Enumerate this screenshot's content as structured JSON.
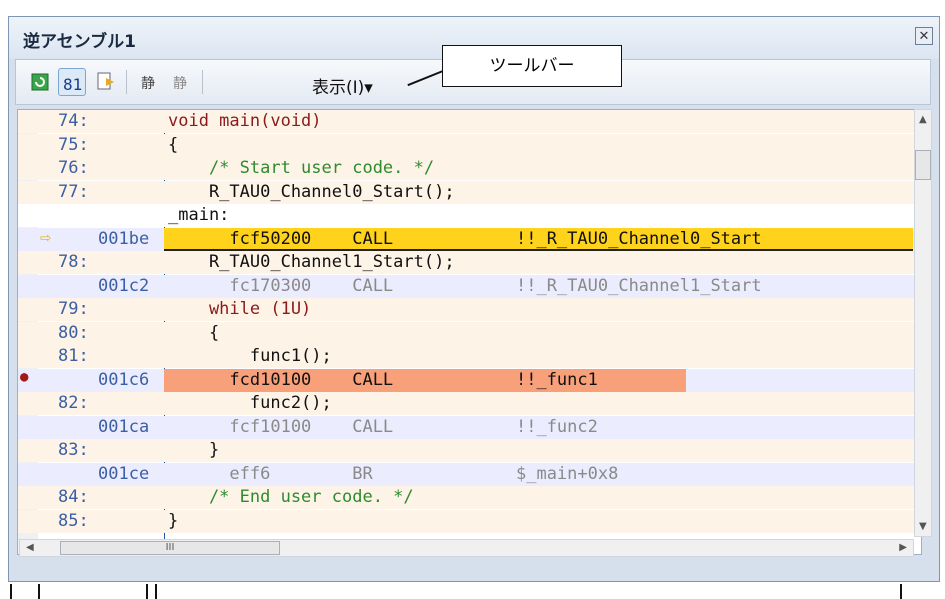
{
  "window": {
    "title": "逆アセンブル1",
    "close_glyph": "✕"
  },
  "toolbar": {
    "buttons": [
      {
        "icon": "refresh-icon"
      },
      {
        "icon": "mixed-display-icon",
        "selected": true
      },
      {
        "icon": "jump-to-icon"
      },
      {
        "icon": "step-in-icon"
      },
      {
        "icon": "step-over-icon"
      }
    ],
    "menu_label": "表示(I)▾"
  },
  "callout": {
    "text": "ツールバー"
  },
  "rows": [
    {
      "addr": "74:",
      "code": "void main(void)",
      "kind": "src",
      "cls": "c-kw"
    },
    {
      "addr": "75:",
      "code": "{",
      "kind": "src",
      "cls": "c-txt"
    },
    {
      "addr": "76:",
      "code": "    /* Start user code. */",
      "kind": "src",
      "cls": "c-cmt"
    },
    {
      "addr": "77:",
      "code": "    R_TAU0_Channel0_Start();",
      "kind": "src",
      "cls": "c-txt"
    },
    {
      "addr": "",
      "code": "_main:",
      "kind": "lbl",
      "cls": "c-txt"
    },
    {
      "addr": "001be",
      "code": "      fcf50200    CALL            !!_R_TAU0_Channel0_Start",
      "kind": "dis",
      "mark": "pc",
      "cls": "c-txt"
    },
    {
      "addr": "78:",
      "code": "    R_TAU0_Channel1_Start();",
      "kind": "src",
      "cls": "c-txt"
    },
    {
      "addr": "001c2",
      "code": "      fc170300    CALL            !!_R_TAU0_Channel1_Start",
      "kind": "dis",
      "cls": "c-gray"
    },
    {
      "addr": "79:",
      "code": "    while (1U)",
      "kind": "src",
      "cls": "c-kw"
    },
    {
      "addr": "80:",
      "code": "    {",
      "kind": "src",
      "cls": "c-txt"
    },
    {
      "addr": "81:",
      "code": "        func1();",
      "kind": "src",
      "cls": "c-txt"
    },
    {
      "addr": "001c6",
      "code": "      fcd10100    CALL            !!_func1",
      "kind": "dis",
      "mark": "bp",
      "cls": "c-txt"
    },
    {
      "addr": "82:",
      "code": "        func2();",
      "kind": "src",
      "cls": "c-txt"
    },
    {
      "addr": "001ca",
      "code": "      fcf10100    CALL            !!_func2",
      "kind": "dis",
      "cls": "c-gray"
    },
    {
      "addr": "83:",
      "code": "    }",
      "kind": "src",
      "cls": "c-txt"
    },
    {
      "addr": "001ce",
      "code": "      eff6        BR              $_main+0x8",
      "kind": "dis",
      "cls": "c-gray"
    },
    {
      "addr": "84:",
      "code": "    /* End user code. */",
      "kind": "src",
      "cls": "c-cmt"
    },
    {
      "addr": "85:",
      "code": "}",
      "kind": "src",
      "cls": "c-txt"
    }
  ],
  "scrollbar": {
    "h_thumb_label": "III"
  }
}
